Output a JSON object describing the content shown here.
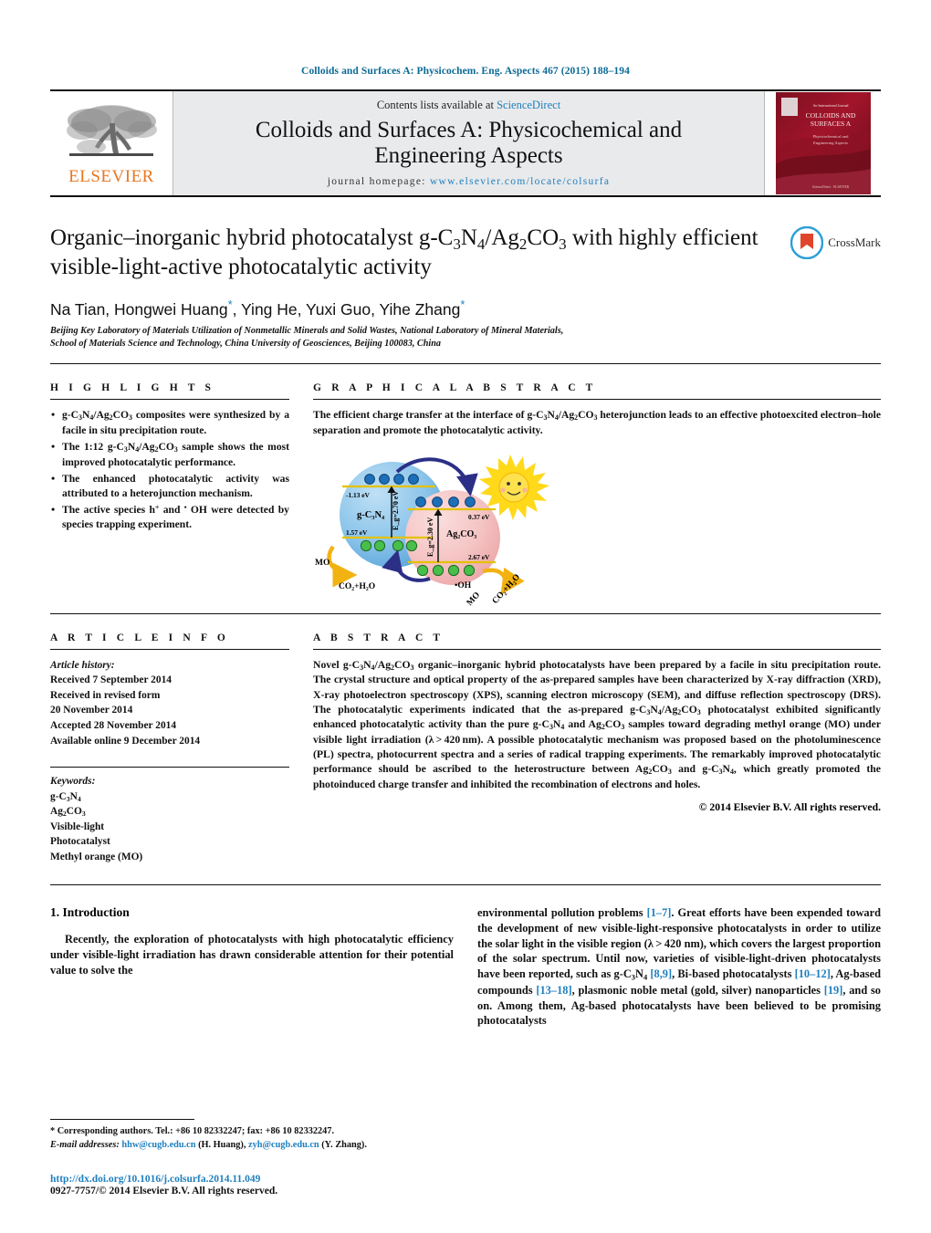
{
  "running_head": "Colloids and Surfaces A: Physicochem. Eng. Aspects 467 (2015) 188–194",
  "masthead": {
    "publisher_name": "ELSEVIER",
    "contents_prefix": "Contents lists available at ",
    "contents_link": "ScienceDirect",
    "journal_title_line1": "Colloids and Surfaces A: Physicochemical and",
    "journal_title_line2": "Engineering Aspects",
    "homepage_label": "journal homepage:",
    "homepage_url": "www.elsevier.com/locate/colsurfa",
    "cover_title_small": "An International Journal",
    "cover_title": "COLLOIDS AND SURFACES A",
    "cover_subtitle": "Physicochemical and Engineering Aspects"
  },
  "article": {
    "title": "Organic–inorganic hybrid photocatalyst g-C3N4/Ag2CO3 with highly efficient visible-light-active photocatalytic activity",
    "crossmark_label": "CrossMark",
    "authors": "Na Tian, Hongwei Huang*, Ying He, Yuxi Guo, Yihe Zhang*",
    "affiliation_line1": "Beijing Key Laboratory of Materials Utilization of Nonmetallic Minerals and Solid Wastes, National Laboratory of Mineral Materials,",
    "affiliation_line2": "School of Materials Science and Technology, China University of Geosciences, Beijing 100083, China"
  },
  "highlights": {
    "heading": "H I G H L I G H T S",
    "items": [
      "g-C3N4/Ag2CO3 composites were synthesized by a facile in situ precipitation route.",
      "The 1:12 g-C3N4/Ag2CO3 sample shows the most improved photocatalytic performance.",
      "The enhanced photocatalytic activity was attributed to a heterojunction mechanism.",
      "The active species h+ and •OH were detected by species trapping experiment."
    ]
  },
  "graphical_abstract": {
    "heading": "G R A P H I C A L   A B S T R A C T",
    "text": "The efficient charge transfer at the interface of g-C3N4/Ag2CO3 heterojunction leads to an effective photoexcited electron–hole separation and promote the photocatalytic activity.",
    "figure": {
      "left_sphere_label": "g-C3N4",
      "left_cb_value": "-1.13 eV",
      "left_vb_value": "1.57 eV",
      "left_gap_label": "Eg=2.70 eV",
      "right_sphere_label": "Ag2CO3",
      "right_cb_value": "0.37 eV",
      "right_vb_value": "2.67 eV",
      "right_gap_label": "Eg=2.30 eV",
      "reactant_left": "MO",
      "product_left": "CO2+H2O",
      "radical_label": "•OH",
      "reactant_right": "MO",
      "product_right": "CO2+H2O",
      "electron_symbol": "e-",
      "hole_symbol": "h+"
    }
  },
  "article_info": {
    "heading": "A R T I C L E   I N F O",
    "history_label": "Article history:",
    "history": [
      "Received 7 September 2014",
      "Received in revised form",
      "20 November 2014",
      "Accepted 28 November 2014",
      "Available online 9 December 2014"
    ],
    "keywords_label": "Keywords:",
    "keywords": [
      "g-C3N4",
      "Ag2CO3",
      "Visible-light",
      "Photocatalyst",
      "Methyl orange (MO)"
    ]
  },
  "abstract": {
    "heading": "A B S T R A C T",
    "text": "Novel g-C3N4/Ag2CO3 organic–inorganic hybrid photocatalysts have been prepared by a facile in situ precipitation route. The crystal structure and optical property of the as-prepared samples have been characterized by X-ray diffraction (XRD), X-ray photoelectron spectroscopy (XPS), scanning electron microscopy (SEM), and diffuse reflection spectroscopy (DRS). The photocatalytic experiments indicated that the as-prepared g-C3N4/Ag2CO3 photocatalyst exhibited significantly enhanced photocatalytic activity than the pure g-C3N4 and Ag2CO3 samples toward degrading methyl orange (MO) under visible light irradiation (λ > 420 nm). A possible photocatalytic mechanism was proposed based on the photoluminescence (PL) spectra, photocurrent spectra and a series of radical trapping experiments. The remarkably improved photocatalytic performance should be ascribed to the heterostructure between Ag2CO3 and g-C3N4, which greatly promoted the photoinduced charge transfer and inhibited the recombination of electrons and holes.",
    "copyright": "© 2014 Elsevier B.V. All rights reserved."
  },
  "introduction": {
    "heading": "1.  Introduction",
    "column_left": "Recently, the exploration of photocatalysts with high photocatalytic efficiency under visible-light irradiation has drawn considerable attention for their potential value to solve the",
    "column_right": "environmental pollution problems [1–7]. Great efforts have been expended toward the development of new visible-light-responsive photocatalysts in order to utilize the solar light in the visible region (λ > 420 nm), which covers the largest proportion of the solar spectrum. Until now, varieties of visible-light-driven photocatalysts have been reported, such as g-C3N4 [8,9], Bi-based photocatalysts [10–12], Ag-based compounds [13–18], plasmonic noble metal (gold, silver) nanoparticles [19], and so on. Among them, Ag-based photocatalysts have been believed to be promising photocatalysts"
  },
  "footnotes": {
    "corresponding": "*  Corresponding authors. Tel.: +86 10 82332247; fax: +86 10 82332247.",
    "email_label": "E-mail addresses:",
    "email1": "hhw@cugb.edu.cn",
    "email1_owner": "(H. Huang),",
    "email2": "zyh@cugb.edu.cn",
    "email2_owner": "(Y. Zhang)."
  },
  "footer": {
    "doi": "http://dx.doi.org/10.1016/j.colsurfa.2014.11.049",
    "issn_line": "0927-7757/© 2014 Elsevier B.V. All rights reserved."
  },
  "colors": {
    "link": "#1f7fbf",
    "runhead": "#0b6a96",
    "elsevier_orange": "#E87722",
    "masthead_bg": "#e9eaeb"
  }
}
